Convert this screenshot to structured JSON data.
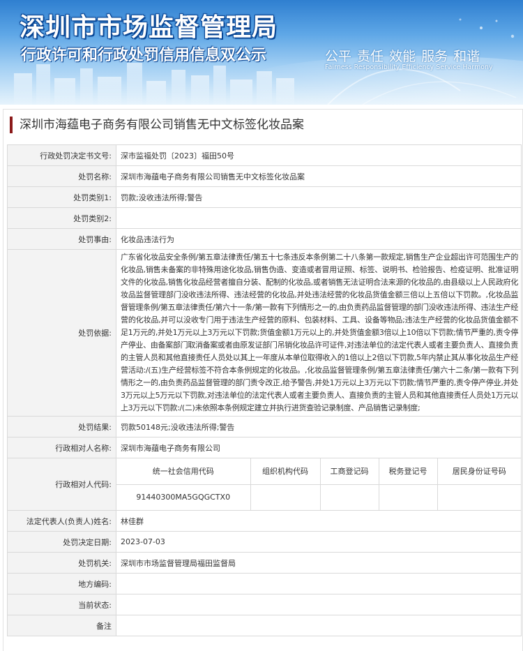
{
  "banner": {
    "title_main": "深圳市市场监督管理局",
    "title_sub": "行政许可和行政处罚信用信息双公示",
    "slogan": "公平  责任  效能  服务  和谐",
    "slogan_en": "Fairness  Responsibility  Efficiency  Service  Harmony"
  },
  "case_title": "深圳市海蕴电子商务有限公司销售无中文标签化妆品案",
  "fields": {
    "decision_no": {
      "label": "行政处罚决定书文号:",
      "value": "深市监福处罚〔2023〕福田50号"
    },
    "penalty_name": {
      "label": "处罚名称:",
      "value": "深圳市海蕴电子商务有限公司销售无中文标签化妆品案"
    },
    "category1": {
      "label": "处罚类别1:",
      "value": "罚款;没收违法所得;警告"
    },
    "category2": {
      "label": "处罚类别2:",
      "value": ""
    },
    "reason": {
      "label": "处罚事由:",
      "value": "化妆品违法行为"
    },
    "basis": {
      "label": "处罚依据:",
      "value": "广东省化妆品安全条例/第五章法律责任/第五十七条违反本条例第二十八条第一款规定,销售生产企业超出许可范围生产的化妆品,销售未备案的非特殊用途化妆品,销售伪造、变造或者冒用证照、标签、说明书、检验报告、检疫证明、批准证明文件的化妆品,销售化妆品经营者擅自分装、配制的化妆品,或者销售无法证明合法来源的化妆品的,由县级以上人民政府化妆品监督管理部门没收违法所得、违法经营的化妆品,并处违法经营的化妆品货值金额三倍以上五倍以下罚款。,化妆品监督管理条例/第五章法律责任/第六十一条/第一款有下列情形之一的,由负责药品监督管理的部门没收违法所得、违法生产经营的化妆品,并可以没收专门用于违法生产经营的原料、包装材料、工具、设备等物品;违法生产经营的化妆品货值金额不足1万元的,并处1万元以上3万元以下罚款;货值金额1万元以上的,并处货值金额3倍以上10倍以下罚款;情节严重的,责令停产停业、由备案部门取消备案或者由原发证部门吊销化妆品许可证件,对违法单位的法定代表人或者主要负责人、直接负责的主管人员和其他直接责任人员处以其上一年度从本单位取得收入的1倍以上2倍以下罚款,5年内禁止其从事化妆品生产经营活动:/(五)生产经营标签不符合本条例规定的化妆品。,化妆品监督管理条例/第五章法律责任/第六十二条/第一款有下列情形之一的,由负责药品监督管理的部门责令改正,给予警告,并处1万元以上3万元以下罚款;情节严重的,责令停产停业,并处3万元以上5万元以下罚款,对违法单位的法定代表人或者主要负责人、直接负责的主管人员和其他直接责任人员处1万元以上3万元以下罚款:/(二)未依照本条例规定建立并执行进货查验记录制度、产品销售记录制度;"
    },
    "result": {
      "label": "处罚结果:",
      "value": "罚款50148元;没收违法所得;警告"
    },
    "counterpart": {
      "label": "行政相对人名称:",
      "value": "深圳市海蕴电子商务有限公司"
    },
    "code": {
      "label": "行政相对人代码:"
    },
    "legal_rep": {
      "label": "法定代表人(负责人)姓名:",
      "value": "林佳群"
    },
    "decision_date": {
      "label": "处罚决定日期:",
      "value": "2023-07-03"
    },
    "authority": {
      "label": "处罚机关:",
      "value": "深圳市市场监督管理局福田监督局"
    },
    "local_code": {
      "label": "地方编码:",
      "value": ""
    },
    "status": {
      "label": "当前状态:",
      "value": ""
    },
    "remark": {
      "label": "备注",
      "value": ""
    }
  },
  "codes": {
    "headers": [
      "统一社会信用代码",
      "组织机构代码",
      "工商登记码",
      "税务登记号",
      "居民身份证号码"
    ],
    "values": [
      "91440300MA5GQGCTX0",
      "",
      "",
      "",
      ""
    ]
  },
  "colors": {
    "accent_bar": "#8b1a1a",
    "label_bg": "#f3f3f3",
    "border": "#d9d9d9",
    "banner_blue": "#2f7fd0"
  }
}
